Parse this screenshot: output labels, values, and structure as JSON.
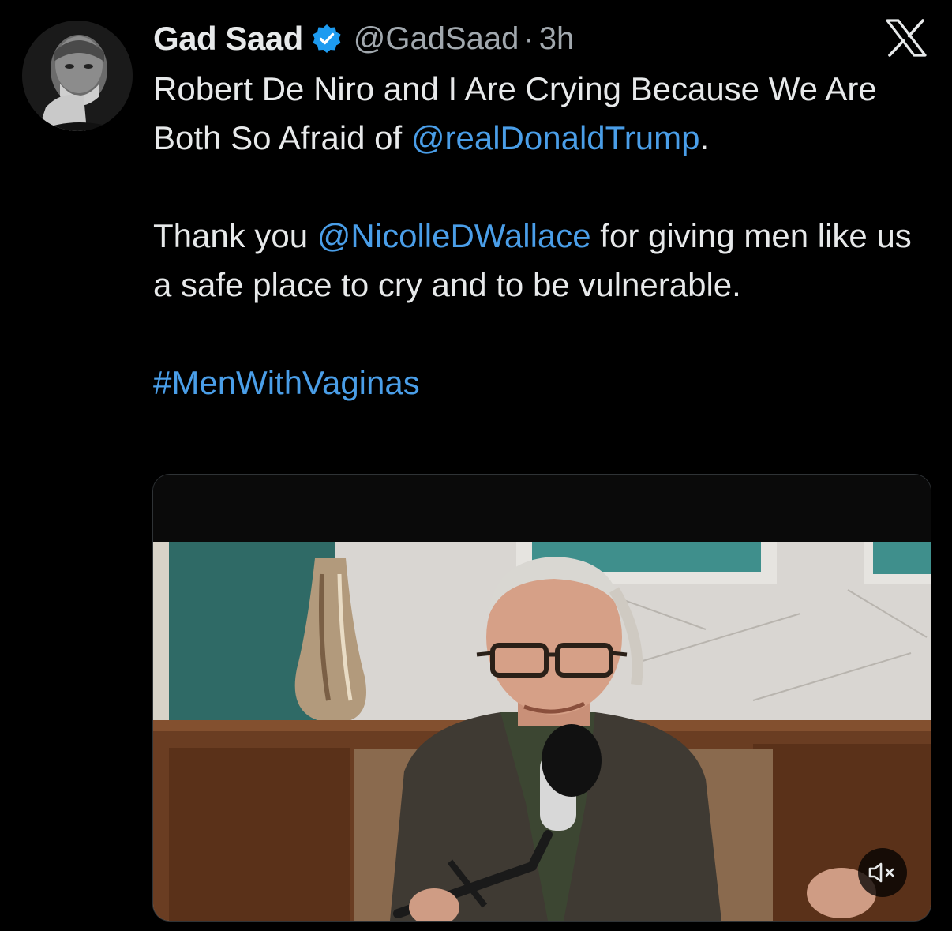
{
  "author": {
    "display_name": "Gad Saad",
    "handle": "@GadSaad",
    "separator": "·",
    "time_ago": "3h",
    "verified": true
  },
  "tweet": {
    "line1_text": "Robert De Niro and I Are Crying Because We Are Both So Afraid of ",
    "line1_mention": "@realDonaldTrump",
    "line1_end": ".",
    "para2_start": "Thank you ",
    "para2_mention": "@NicolleDWallace",
    "para2_rest": " for giving men like us a safe place to cry and to be vulnerable.",
    "hashtag": "#MenWithVaginas"
  },
  "media": {
    "type": "video",
    "muted": true
  },
  "colors": {
    "background": "#000000",
    "text": "#e7e9ea",
    "secondary_text": "#a1a8ae",
    "link": "#4a9ee8",
    "verified_badge": "#1d9bf0"
  },
  "icons": {
    "verified": "verified-badge-icon",
    "platform": "x-logo-icon",
    "mute": "speaker-muted-icon"
  }
}
